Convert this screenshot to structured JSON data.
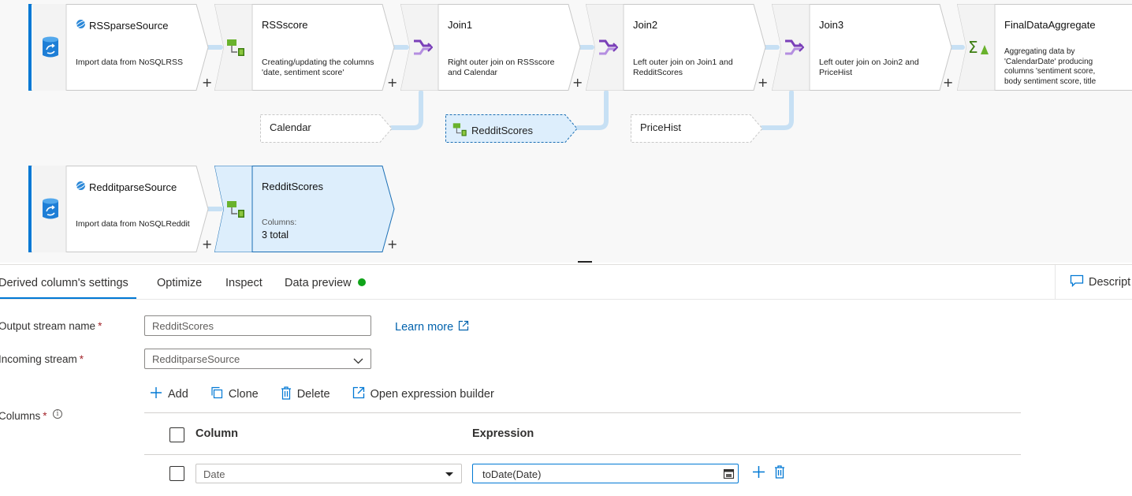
{
  "canvas": {
    "nodes": [
      {
        "title": "RSSparseSource",
        "description": "Import data from NoSQLRSS",
        "kind": "source"
      },
      {
        "title": "RSSscore",
        "description": "Creating/updating the columns 'date, sentiment score'",
        "kind": "derived"
      },
      {
        "title": "Join1",
        "description": "Right outer join on RSSscore and Calendar",
        "kind": "join"
      },
      {
        "title": "Join2",
        "description": "Left outer join on Join1 and RedditScores",
        "kind": "join"
      },
      {
        "title": "Join3",
        "description": "Left outer join on Join2 and PriceHist",
        "kind": "join"
      },
      {
        "title": "FinalDataAggregate",
        "description": "Aggregating data by 'CalendarDate' producing columns 'sentiment score, body sentiment score, title",
        "kind": "aggregate"
      },
      {
        "title": "RedditparseSource",
        "description": "Import data from NoSQLReddit",
        "kind": "source"
      },
      {
        "title": "RedditScores",
        "columns_label": "Columns:",
        "columns_value": "3 total",
        "kind": "derived",
        "selected": true
      }
    ],
    "references": [
      "Calendar",
      "RedditScores",
      "PriceHist"
    ],
    "plus_symbol": "+"
  },
  "panel": {
    "tabs": [
      "Derived column's settings",
      "Optimize",
      "Inspect",
      "Data preview"
    ],
    "active_tab": "Derived column's settings",
    "description_button": "Descript",
    "output_stream": {
      "label": "Output stream name",
      "value": "RedditScores",
      "required": "*"
    },
    "incoming_stream": {
      "label": "Incoming stream",
      "value": "RedditparseSource",
      "required": "*"
    },
    "learn_more": "Learn more",
    "columns_label": "Columns",
    "columns_required": "*",
    "info_symbol": "i",
    "toolbar": {
      "add": "Add",
      "clone": "Clone",
      "delete": "Delete",
      "open_builder": "Open expression builder"
    },
    "table": {
      "headers": {
        "column": "Column",
        "expression": "Expression"
      },
      "rows": [
        {
          "column": "Date",
          "expression": "toDate(Date)"
        }
      ]
    }
  },
  "colors": {
    "accent": "#0078d4",
    "canvas_bg": "#f8f8f8",
    "selected_node": "#ddeefc",
    "connector": "#c7e0f4",
    "status_green": "#10a319"
  },
  "icons": [
    "database-icon",
    "cosmos-icon",
    "derived-column-icon",
    "join-icon",
    "aggregate-icon",
    "external-link-icon",
    "comment-icon",
    "plus-icon",
    "copy-icon",
    "trash-icon",
    "calendar-icon",
    "chevron-down-icon"
  ]
}
